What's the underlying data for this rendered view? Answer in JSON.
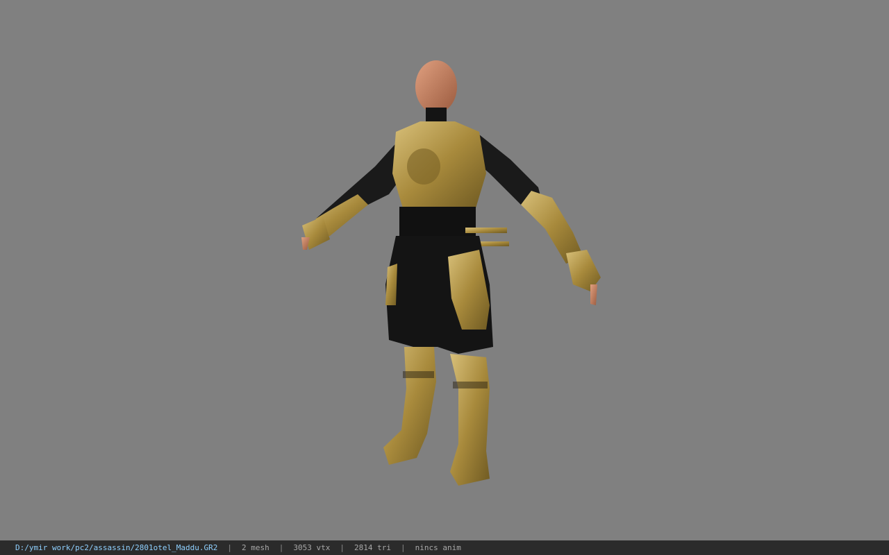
{
  "viewer": {
    "background_color": "#808080",
    "model_icon": "armored-character-model"
  },
  "status": {
    "file_path": "D:/ymir work/pc2/assassin/2801otel_Maddu.GR2",
    "separator": "|",
    "mesh": "2 mesh",
    "vertices": "3053 vtx",
    "triangles": "2814 tri",
    "anim": "nincs anim"
  }
}
